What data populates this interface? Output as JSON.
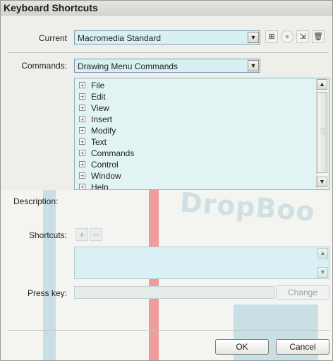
{
  "window": {
    "title": "Keyboard Shortcuts"
  },
  "current": {
    "label": "Current",
    "value": "Macromedia Standard",
    "toolbar_icons": [
      "duplicate-set-icon",
      "rename-set-icon",
      "export-html-icon",
      "delete-set-icon"
    ]
  },
  "commands": {
    "label": "Commands:",
    "value": "Drawing Menu Commands",
    "tree_items": [
      "File",
      "Edit",
      "View",
      "Insert",
      "Modify",
      "Text",
      "Commands",
      "Control",
      "Window",
      "Help"
    ]
  },
  "description": {
    "label": "Description:"
  },
  "shortcuts": {
    "label": "Shortcuts:",
    "add": "+",
    "remove": "−"
  },
  "press_key": {
    "label": "Press key:",
    "change": "Change"
  },
  "buttons": {
    "ok": "OK",
    "cancel": "Cancel"
  },
  "watermark": {
    "text": "DropBoo"
  }
}
